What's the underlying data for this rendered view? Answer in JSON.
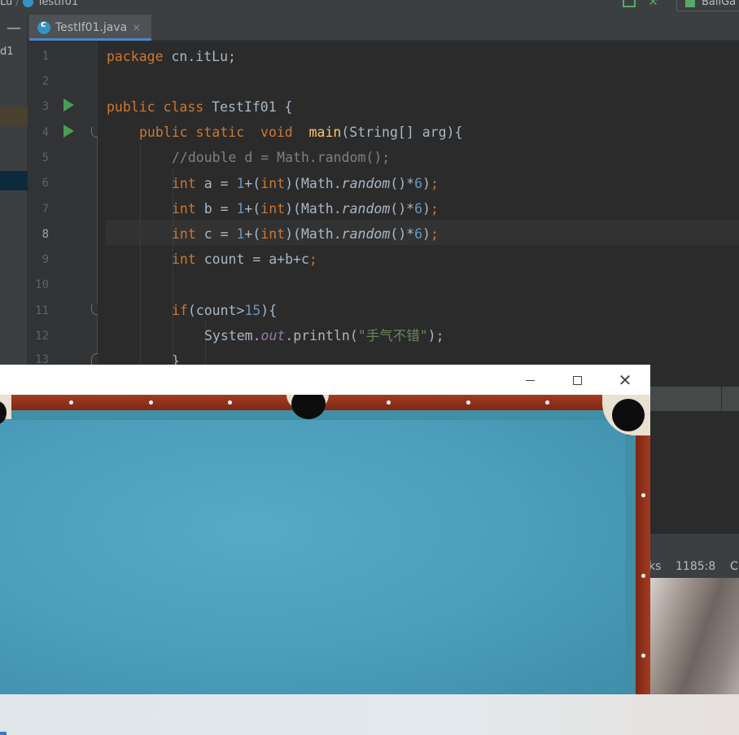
{
  "breadcrumb": {
    "package": "Lu",
    "file": "TestIf01"
  },
  "toolbar": {
    "run_config": "BallGa"
  },
  "left_panel": {
    "label": "d1"
  },
  "tab": {
    "label": "TestIf01.java",
    "close": "×"
  },
  "editor": {
    "lines": [
      "1",
      "2",
      "3",
      "4",
      "5",
      "6",
      "7",
      "8",
      "9",
      "10",
      "11",
      "12",
      "13"
    ],
    "current_line": 8,
    "code": {
      "l1_kw": "package",
      "l1_rest": " cn.itLu;",
      "l3_kw": "public class",
      "l3_rest": " TestIf01 {",
      "l4_kw": "public static  void",
      "l4_fn": "main",
      "l4_rest": "(String[] arg){",
      "l5_comment": "//double d = Math.random();",
      "l6": "int a = 1+(int)(Math.random()*6);",
      "l7": "int b = 1+(int)(Math.random()*6);",
      "l8": "int c = 1+(int)(Math.random()*6);",
      "l9": "int count = a+b+c;",
      "l11": "if(count>15){",
      "l12_obj": "System.",
      "l12_field": "out",
      "l12_call": ".println(",
      "l12_str": "\"手气不错\"",
      "l12_end": ");",
      "l13": "}"
    }
  },
  "status_bar": {
    "cursor": "1185:8",
    "left_fragment": "ks",
    "right_fragment": "C"
  },
  "game_window": {
    "minimize": "—",
    "maximize": "□",
    "close": "✕"
  }
}
